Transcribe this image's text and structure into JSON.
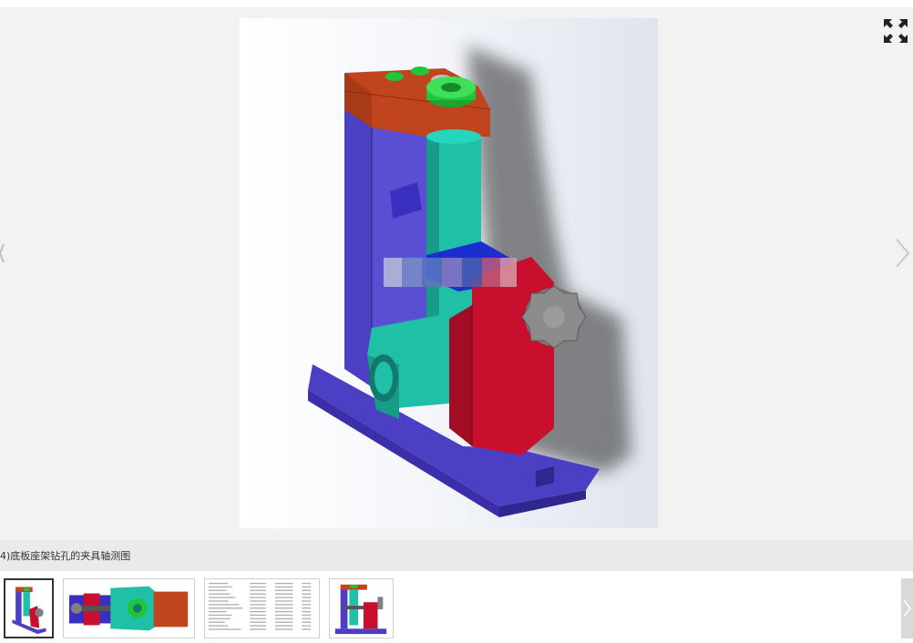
{
  "viewer": {
    "caption": "4)底板座架钻孔的夹具轴测图",
    "main_image": {
      "icon": "fixture-isometric-image"
    },
    "fullscreen": {
      "icon": "fullscreen-icon"
    },
    "nav": {
      "prev_icon": "chevron-left-icon",
      "next_icon": "chevron-right-icon"
    }
  },
  "thumbnails": [
    {
      "icon": "fixture-isometric-thumbnail",
      "selected": true
    },
    {
      "icon": "fixture-top-view-thumbnail",
      "selected": false
    },
    {
      "icon": "file-list-thumbnail",
      "selected": false
    },
    {
      "icon": "fixture-front-view-thumbnail",
      "selected": false
    }
  ],
  "colors": {
    "base_blue": "#4b3fc4",
    "column_teal": "#1fbfa8",
    "plate_orange": "#c0451f",
    "bracket_red": "#c8102e",
    "bushing_green": "#22c43a",
    "knob_gray": "#808080"
  }
}
